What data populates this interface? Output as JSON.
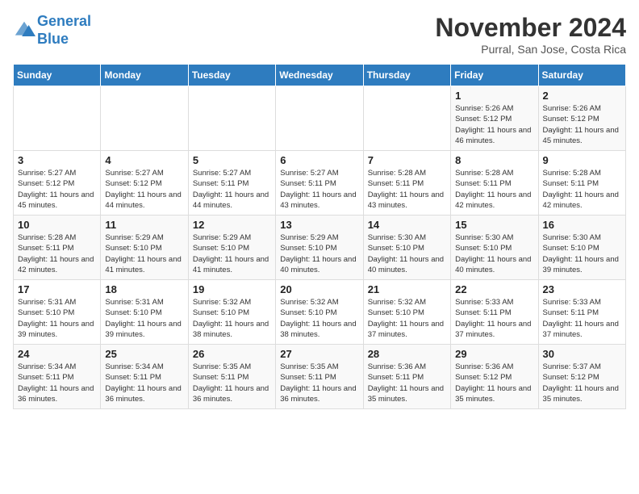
{
  "header": {
    "logo_line1": "General",
    "logo_line2": "Blue",
    "month": "November 2024",
    "location": "Purral, San Jose, Costa Rica"
  },
  "days_of_week": [
    "Sunday",
    "Monday",
    "Tuesday",
    "Wednesday",
    "Thursday",
    "Friday",
    "Saturday"
  ],
  "weeks": [
    [
      {
        "day": "",
        "info": ""
      },
      {
        "day": "",
        "info": ""
      },
      {
        "day": "",
        "info": ""
      },
      {
        "day": "",
        "info": ""
      },
      {
        "day": "",
        "info": ""
      },
      {
        "day": "1",
        "info": "Sunrise: 5:26 AM\nSunset: 5:12 PM\nDaylight: 11 hours and 46 minutes."
      },
      {
        "day": "2",
        "info": "Sunrise: 5:26 AM\nSunset: 5:12 PM\nDaylight: 11 hours and 45 minutes."
      }
    ],
    [
      {
        "day": "3",
        "info": "Sunrise: 5:27 AM\nSunset: 5:12 PM\nDaylight: 11 hours and 45 minutes."
      },
      {
        "day": "4",
        "info": "Sunrise: 5:27 AM\nSunset: 5:12 PM\nDaylight: 11 hours and 44 minutes."
      },
      {
        "day": "5",
        "info": "Sunrise: 5:27 AM\nSunset: 5:11 PM\nDaylight: 11 hours and 44 minutes."
      },
      {
        "day": "6",
        "info": "Sunrise: 5:27 AM\nSunset: 5:11 PM\nDaylight: 11 hours and 43 minutes."
      },
      {
        "day": "7",
        "info": "Sunrise: 5:28 AM\nSunset: 5:11 PM\nDaylight: 11 hours and 43 minutes."
      },
      {
        "day": "8",
        "info": "Sunrise: 5:28 AM\nSunset: 5:11 PM\nDaylight: 11 hours and 42 minutes."
      },
      {
        "day": "9",
        "info": "Sunrise: 5:28 AM\nSunset: 5:11 PM\nDaylight: 11 hours and 42 minutes."
      }
    ],
    [
      {
        "day": "10",
        "info": "Sunrise: 5:28 AM\nSunset: 5:11 PM\nDaylight: 11 hours and 42 minutes."
      },
      {
        "day": "11",
        "info": "Sunrise: 5:29 AM\nSunset: 5:10 PM\nDaylight: 11 hours and 41 minutes."
      },
      {
        "day": "12",
        "info": "Sunrise: 5:29 AM\nSunset: 5:10 PM\nDaylight: 11 hours and 41 minutes."
      },
      {
        "day": "13",
        "info": "Sunrise: 5:29 AM\nSunset: 5:10 PM\nDaylight: 11 hours and 40 minutes."
      },
      {
        "day": "14",
        "info": "Sunrise: 5:30 AM\nSunset: 5:10 PM\nDaylight: 11 hours and 40 minutes."
      },
      {
        "day": "15",
        "info": "Sunrise: 5:30 AM\nSunset: 5:10 PM\nDaylight: 11 hours and 40 minutes."
      },
      {
        "day": "16",
        "info": "Sunrise: 5:30 AM\nSunset: 5:10 PM\nDaylight: 11 hours and 39 minutes."
      }
    ],
    [
      {
        "day": "17",
        "info": "Sunrise: 5:31 AM\nSunset: 5:10 PM\nDaylight: 11 hours and 39 minutes."
      },
      {
        "day": "18",
        "info": "Sunrise: 5:31 AM\nSunset: 5:10 PM\nDaylight: 11 hours and 39 minutes."
      },
      {
        "day": "19",
        "info": "Sunrise: 5:32 AM\nSunset: 5:10 PM\nDaylight: 11 hours and 38 minutes."
      },
      {
        "day": "20",
        "info": "Sunrise: 5:32 AM\nSunset: 5:10 PM\nDaylight: 11 hours and 38 minutes."
      },
      {
        "day": "21",
        "info": "Sunrise: 5:32 AM\nSunset: 5:10 PM\nDaylight: 11 hours and 37 minutes."
      },
      {
        "day": "22",
        "info": "Sunrise: 5:33 AM\nSunset: 5:11 PM\nDaylight: 11 hours and 37 minutes."
      },
      {
        "day": "23",
        "info": "Sunrise: 5:33 AM\nSunset: 5:11 PM\nDaylight: 11 hours and 37 minutes."
      }
    ],
    [
      {
        "day": "24",
        "info": "Sunrise: 5:34 AM\nSunset: 5:11 PM\nDaylight: 11 hours and 36 minutes."
      },
      {
        "day": "25",
        "info": "Sunrise: 5:34 AM\nSunset: 5:11 PM\nDaylight: 11 hours and 36 minutes."
      },
      {
        "day": "26",
        "info": "Sunrise: 5:35 AM\nSunset: 5:11 PM\nDaylight: 11 hours and 36 minutes."
      },
      {
        "day": "27",
        "info": "Sunrise: 5:35 AM\nSunset: 5:11 PM\nDaylight: 11 hours and 36 minutes."
      },
      {
        "day": "28",
        "info": "Sunrise: 5:36 AM\nSunset: 5:11 PM\nDaylight: 11 hours and 35 minutes."
      },
      {
        "day": "29",
        "info": "Sunrise: 5:36 AM\nSunset: 5:12 PM\nDaylight: 11 hours and 35 minutes."
      },
      {
        "day": "30",
        "info": "Sunrise: 5:37 AM\nSunset: 5:12 PM\nDaylight: 11 hours and 35 minutes."
      }
    ]
  ]
}
